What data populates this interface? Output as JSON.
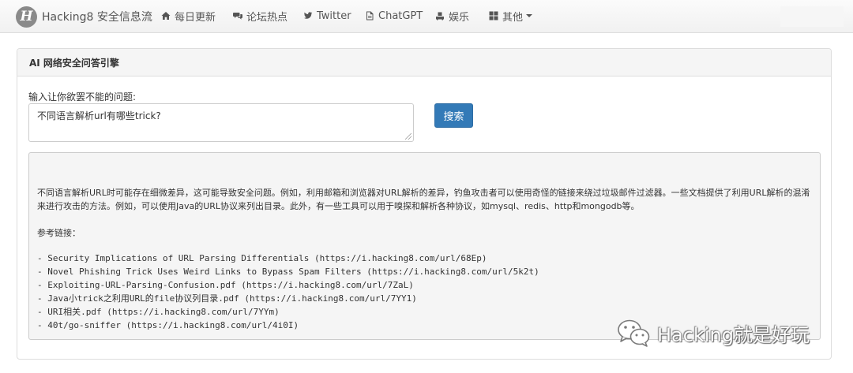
{
  "navbar": {
    "brand": "Hacking8 安全信息流",
    "logo_letter": "H",
    "items": [
      {
        "label": "每日更新",
        "icon": "home-icon"
      },
      {
        "label": "论坛热点",
        "icon": "comments-icon"
      },
      {
        "label": "Twitter",
        "icon": "twitter-icon"
      },
      {
        "label": "ChatGPT",
        "icon": "file-icon"
      },
      {
        "label": "娱乐",
        "icon": "game-icon"
      },
      {
        "label": "其他",
        "icon": "grid-icon",
        "dropdown": true
      }
    ]
  },
  "panel": {
    "title": "AI 网络安全问答引擎",
    "question_label": "输入让你欲罢不能的问题:",
    "question_value": "不同语言解析url有哪些trick?",
    "search_button": "搜索",
    "answer": {
      "paragraph": "不同语言解析URL时可能存在细微差异，这可能导致安全问题。例如，利用邮箱和浏览器对URL解析的差异，钓鱼攻击者可以使用奇怪的链接来绕过垃圾邮件过滤器。一些文档提供了利用URL解析的混淆来进行攻击的方法。例如，可以使用Java的URL协议来列出目录。此外，有一些工具可以用于嗅探和解析各种协议，如mysql、redis、http和mongodb等。",
      "references_title": "参考链接：",
      "references": [
        "- Security Implications of URL Parsing Differentials (https://i.hacking8.com/url/68Ep)",
        "- Novel Phishing Trick Uses Weird Links to Bypass Spam Filters (https://i.hacking8.com/url/5k2t)",
        "- Exploiting-URL-Parsing-Confusion.pdf (https://i.hacking8.com/url/7ZaL)",
        "- Java小trick之利用URL的file协议列目录.pdf (https://i.hacking8.com/url/7YY1)",
        "- URI相关.pdf (https://i.hacking8.com/url/7YYm)",
        "- 40t/go-sniffer (https://i.hacking8.com/url/4i0I)"
      ]
    }
  },
  "watermark": {
    "text": "Hacking就是好玩",
    "icon": "wechat-icon"
  },
  "colors": {
    "primary_button": "#337ab7",
    "navbar_bg": "#f8f8f8",
    "panel_heading_bg": "#f5f5f5",
    "answer_bg": "#f5f5f5"
  }
}
